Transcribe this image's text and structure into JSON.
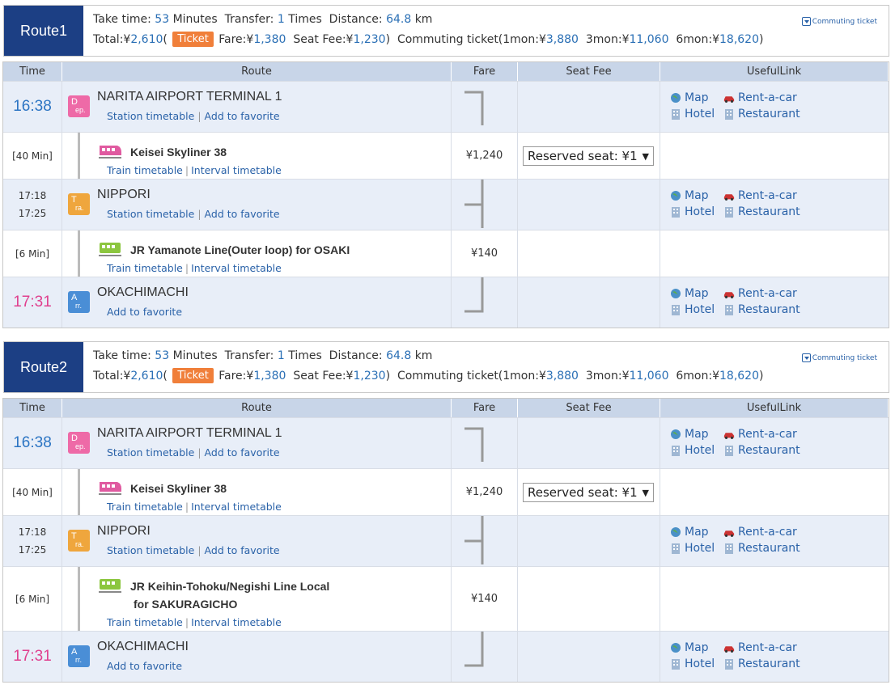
{
  "summary": {
    "take_time_label": "Take time:",
    "take_time_value": "53",
    "take_time_unit": "Minutes",
    "transfer_label": "Transfer:",
    "transfer_value": "1",
    "transfer_unit": "Times",
    "distance_label": "Distance:",
    "distance_value": "64.8",
    "distance_unit": "km",
    "total_label": "Total:¥",
    "total_value": "2,610",
    "open_paren": "(",
    "ticket_button": "Ticket",
    "fare_label": "Fare:¥",
    "fare_value": "1,380",
    "seat_label": "Seat Fee:¥",
    "seat_value": "1,230",
    "commute_label": "Commuting ticket(",
    "m1_label": "1mon:¥",
    "m1_value": "3,880",
    "m3_label": "3mon:¥",
    "m3_value": "11,060",
    "m6_label": "6mon:¥",
    "m6_value": "18,620",
    "close_paren": ")",
    "commuting_link": "Commuting ticket"
  },
  "headers": {
    "time": "Time",
    "route": "Route",
    "fare": "Fare",
    "seat_fee": "Seat Fee",
    "useful_link": "UsefulLink"
  },
  "common": {
    "station_timetable": "Station timetable",
    "add_favorite": "Add to favorite",
    "train_timetable": "Train timetable",
    "interval_timetable": "Interval timetable",
    "sep": "|",
    "map": "Map",
    "rent": "Rent-a-car",
    "hotel": "Hotel",
    "restaurant": "Restaurant",
    "reserved": "Reserved seat: ¥1",
    "dep_icon": [
      "D",
      "ep."
    ],
    "tra_icon": [
      "T",
      "ra."
    ],
    "arr_icon": [
      "A",
      "rr."
    ]
  },
  "routes": [
    {
      "label": "Route1",
      "dep_time": "16:38",
      "dep_station": "NARITA AIRPORT TERMINAL 1",
      "leg1_dur": "[40 Min]",
      "leg1_train": "Keisei Skyliner 38",
      "leg1_fare": "¥1,240",
      "tr_arr": "17:18",
      "tr_dep": "17:25",
      "tr_station": "NIPPORI",
      "leg2_dur": "[6 Min]",
      "leg2_train_l1": "JR Yamanote Line(Outer loop)  for OSAKI",
      "leg2_train_l2": "",
      "leg2_fare": "¥140",
      "arr_time": "17:31",
      "arr_station": "OKACHIMACHI"
    },
    {
      "label": "Route2",
      "dep_time": "16:38",
      "dep_station": "NARITA AIRPORT TERMINAL 1",
      "leg1_dur": "[40 Min]",
      "leg1_train": "Keisei Skyliner 38",
      "leg1_fare": "¥1,240",
      "tr_arr": "17:18",
      "tr_dep": "17:25",
      "tr_station": "NIPPORI",
      "leg2_dur": "[6 Min]",
      "leg2_train_l1": "JR Keihin-Tohoku/Negishi Line Local",
      "leg2_train_l2": "for SAKURAGICHO",
      "leg2_fare": "¥140",
      "arr_time": "17:31",
      "arr_station": "OKACHIMACHI"
    }
  ],
  "colors": {
    "route_badge": "#1c3f84",
    "ticket_button": "#f07f3a",
    "header_row": "#c8d5e8",
    "station_row": "#e8eef8",
    "dep_time": "#2b74c3",
    "arr_time": "#e0408e"
  }
}
